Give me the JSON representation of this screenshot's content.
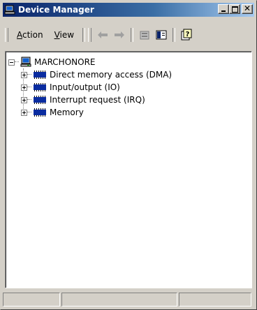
{
  "window": {
    "title": "Device Manager",
    "icon": "computer-icon"
  },
  "caption_buttons": {
    "minimize_icon": "minimize-icon",
    "maximize_icon": "maximize-icon",
    "close_glyph": "✕"
  },
  "menu": {
    "action_label": "Action",
    "action_accel": "A",
    "view_label": "View",
    "view_accel": "V"
  },
  "toolbar": {
    "icons": [
      "back-arrow-icon",
      "forward-arrow-icon",
      "properties-icon",
      "console-tree-icon",
      "help-icon"
    ]
  },
  "tree": {
    "root": {
      "label": "MARCHONORE",
      "icon": "computer-icon",
      "expanded": true
    },
    "children": [
      {
        "label": "Direct memory access (DMA)",
        "icon": "memory-chip-icon",
        "expanded": false
      },
      {
        "label": "Input/output (IO)",
        "icon": "memory-chip-icon",
        "expanded": false
      },
      {
        "label": "Interrupt request (IRQ)",
        "icon": "memory-chip-icon",
        "expanded": false
      },
      {
        "label": "Memory",
        "icon": "memory-chip-icon",
        "expanded": false
      }
    ]
  },
  "status": {
    "panes": [
      "",
      "",
      ""
    ]
  },
  "colors": {
    "titlebar_start": "#0a246a",
    "titlebar_end": "#a6caf0",
    "chrome": "#d4d0c8"
  }
}
